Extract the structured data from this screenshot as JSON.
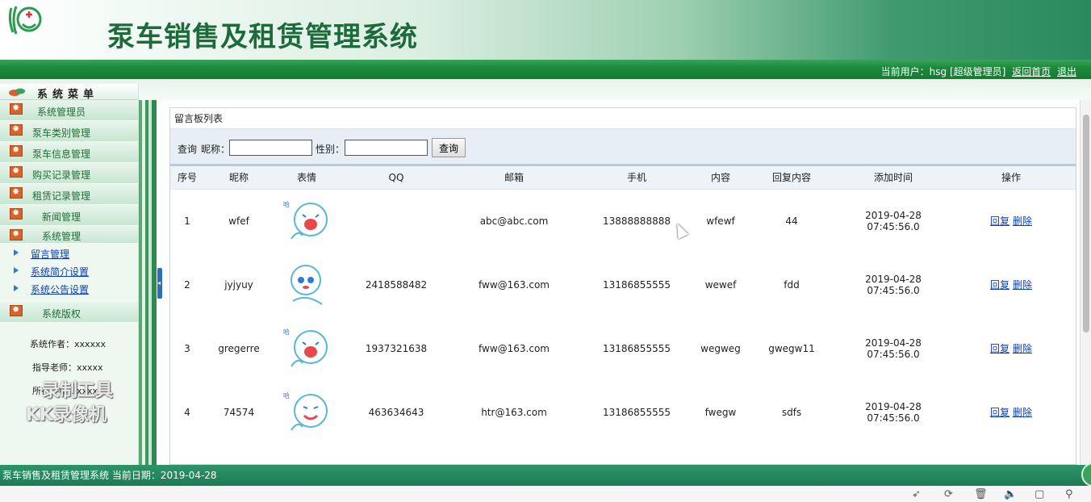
{
  "header": {
    "app_title": "泵车销售及租赁管理系统",
    "current_user_text": "当前用户：hsg [超级管理员]",
    "home_link": "返回首页",
    "logout_link": "退出"
  },
  "sidebar": {
    "menu_title": "系统菜单",
    "items": [
      {
        "label": "系统管理员"
      },
      {
        "label": "泵车类别管理"
      },
      {
        "label": "泵车信息管理"
      },
      {
        "label": "购买记录管理"
      },
      {
        "label": "租赁记录管理"
      },
      {
        "label": "新闻管理"
      },
      {
        "label": "系统管理"
      }
    ],
    "sub_items": [
      {
        "label": "留言管理"
      },
      {
        "label": "系统简介设置"
      },
      {
        "label": "系统公告设置"
      }
    ],
    "copyright_title": "系统版权",
    "author": "系统作者：xxxxxx",
    "teacher": "指导老师：xxxxx",
    "school": "所在学校：xxxx",
    "watermark_line1": "录制工具",
    "watermark_line2": "KK录像机"
  },
  "panel": {
    "title": "留言板列表",
    "search": {
      "prefix": "查询",
      "nickname_label": "昵称：",
      "gender_label": "性别：",
      "nickname_value": "",
      "gender_value": "",
      "button": "查询"
    },
    "columns": [
      "序号",
      "昵称",
      "表情",
      "QQ",
      "邮箱",
      "手机",
      "内容",
      "回复内容",
      "添加时间",
      "操作"
    ],
    "rows": [
      {
        "no": "1",
        "nickname": "wfef",
        "face": "laughing-face-icon",
        "qq": "",
        "email": "abc@abc.com",
        "phone": "13888888888",
        "content": "wfewf",
        "reply": "44",
        "time": "2019-04-28 07:45:56.0",
        "action_reply": "回复",
        "action_delete": "删除"
      },
      {
        "no": "2",
        "nickname": "jyjyuy",
        "face": "thinking-face-icon",
        "qq": "2418588482",
        "email": "fww@163.com",
        "phone": "13186855555",
        "content": "wewef",
        "reply": "fdd",
        "time": "2019-04-28 07:45:56.0",
        "action_reply": "回复",
        "action_delete": "删除"
      },
      {
        "no": "3",
        "nickname": "gregerre",
        "face": "laughing-face-icon",
        "qq": "1937321638",
        "email": "fww@163.com",
        "phone": "13186855555",
        "content": "wegweg",
        "reply": "gwegw11",
        "time": "2019-04-28 07:45:56.0",
        "action_reply": "回复",
        "action_delete": "删除"
      },
      {
        "no": "4",
        "nickname": "74574",
        "face": "smiling-face-icon",
        "qq": "463634643",
        "email": "htr@163.com",
        "phone": "13186855555",
        "content": "fwegw",
        "reply": "sdfs",
        "time": "2019-04-28 07:45:56.0",
        "action_reply": "回复",
        "action_delete": "删除"
      }
    ]
  },
  "footer": {
    "text": "泵车销售及租赁管理系统 当前日期：2019-04-28"
  },
  "colors": {
    "brand_green": "#1d6b3a",
    "band_green": "#1c8a3c",
    "link_blue": "#0f3fb5"
  }
}
